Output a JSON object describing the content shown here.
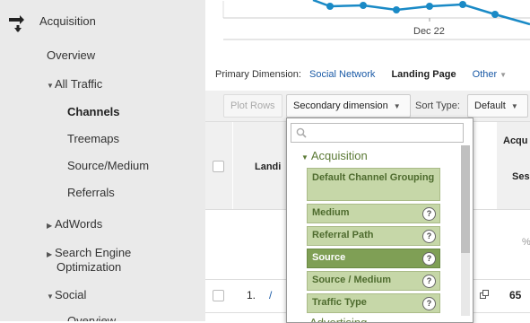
{
  "sidebar": {
    "section_title": "Acquisition",
    "items": [
      {
        "label": "Overview"
      },
      {
        "label": "All Traffic"
      },
      {
        "label": "Channels"
      },
      {
        "label": "Treemaps"
      },
      {
        "label": "Source/Medium"
      },
      {
        "label": "Referrals"
      },
      {
        "label": "AdWords"
      },
      {
        "label": "Search Engine"
      },
      {
        "label": "Optimization"
      },
      {
        "label": "Social"
      },
      {
        "label": "Overview"
      }
    ]
  },
  "chart": {
    "x_tick": "Dec 22",
    "line_color": "#1a8ac6"
  },
  "dimension_bar": {
    "label": "Primary Dimension:",
    "options": [
      "Social Network",
      "Landing Page",
      "Other"
    ]
  },
  "toolbar": {
    "plot_rows": "Plot Rows",
    "secondary_dimension": "Secondary dimension",
    "sort_type_label": "Sort Type:",
    "sort_type_value": "Default"
  },
  "table": {
    "landing_header": "Landi",
    "acq_header": "Acqu",
    "sess_header": "Ses",
    "pct_fragment": "%",
    "row_index": "1.",
    "row_link": "/",
    "row_value": "65"
  },
  "dropdown": {
    "group_title": "Acquisition",
    "options": [
      {
        "label": "Default Channel Grouping",
        "help": false,
        "selected": false
      },
      {
        "label": "Medium",
        "help": true,
        "selected": false
      },
      {
        "label": "Referral Path",
        "help": true,
        "selected": false
      },
      {
        "label": "Source",
        "help": true,
        "selected": true
      },
      {
        "label": "Source / Medium",
        "help": true,
        "selected": false
      },
      {
        "label": "Traffic Type",
        "help": true,
        "selected": false
      }
    ],
    "next_group": "Advertising",
    "help_glyph": "?"
  },
  "colors": {
    "accent_blue": "#1a5aa6",
    "option_green": "#c6d7a8",
    "option_selected": "#7f9f55"
  }
}
